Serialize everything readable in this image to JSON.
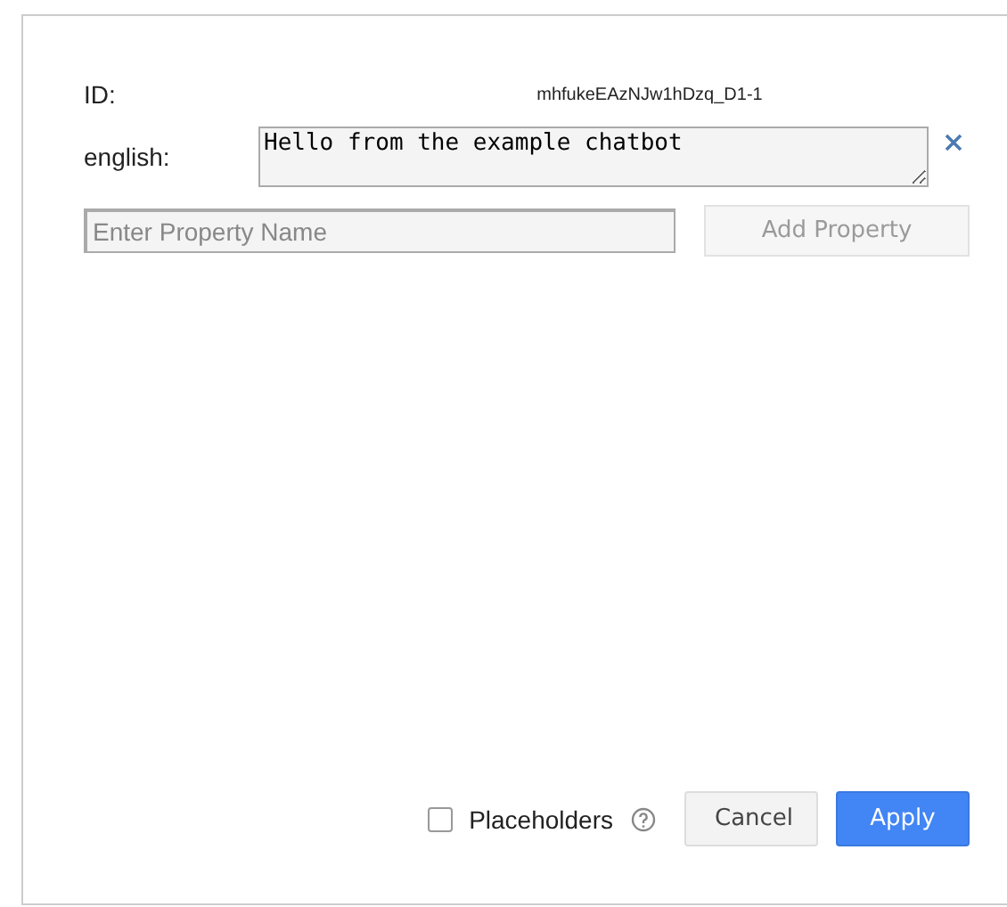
{
  "id_field": {
    "label": "ID:",
    "value": "mhfukeEAzNJw1hDzq_D1-1"
  },
  "translation": {
    "label": "english:",
    "value": "Hello from the example chatbot"
  },
  "property": {
    "placeholder": "Enter Property Name",
    "button": "Add Property"
  },
  "placeholders": {
    "label": "Placeholders",
    "checked": false
  },
  "buttons": {
    "cancel": "Cancel",
    "apply": "Apply"
  }
}
